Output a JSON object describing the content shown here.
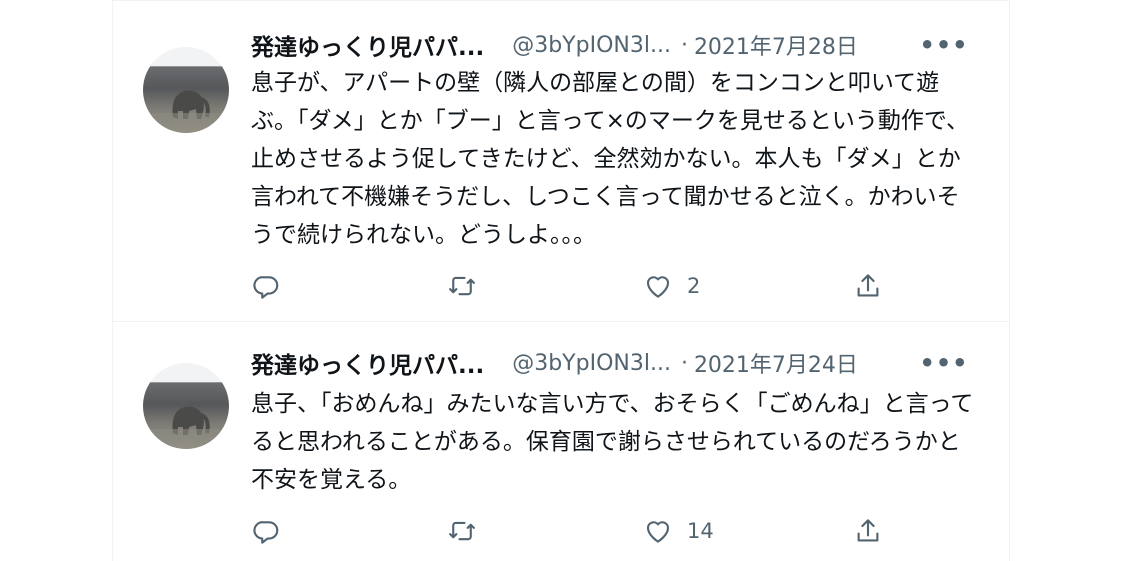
{
  "tweets": [
    {
      "name": "発達ゆっくり児パパ...",
      "handle": "@3bYpION3l...",
      "separator": "·",
      "date": "2021年7月28日",
      "text": "息子が、アパートの壁（隣人の部屋との間）をコンコンと叩いて遊ぶ。「ダメ」とか「ブー」と言って×のマークを見せるという動作で、止めさせるよう促してきたけど、全然効かない。本人も「ダメ」とか言われて不機嫌そうだし、しつこく言って聞かせると泣く。かわいそうで続けられない。どうしよ。。。",
      "likes": "2",
      "more": "•••"
    },
    {
      "name": "発達ゆっくり児パパ...",
      "handle": "@3bYpION3l...",
      "separator": "·",
      "date": "2021年7月24日",
      "text": "息子、「おめんね」みたいな言い方で、おそらく「ごめんね」と言ってると思われることがある。保育園で謝らさせられているのだろうかと不安を覚える。",
      "likes": "14",
      "more": "•••"
    }
  ],
  "icons": {
    "reply": "reply-icon",
    "retweet": "retweet-icon",
    "like": "heart-icon",
    "share": "share-icon",
    "more": "more-icon"
  },
  "colors": {
    "text": "#0f1419",
    "secondary": "#536471",
    "border": "#eff3f4"
  }
}
